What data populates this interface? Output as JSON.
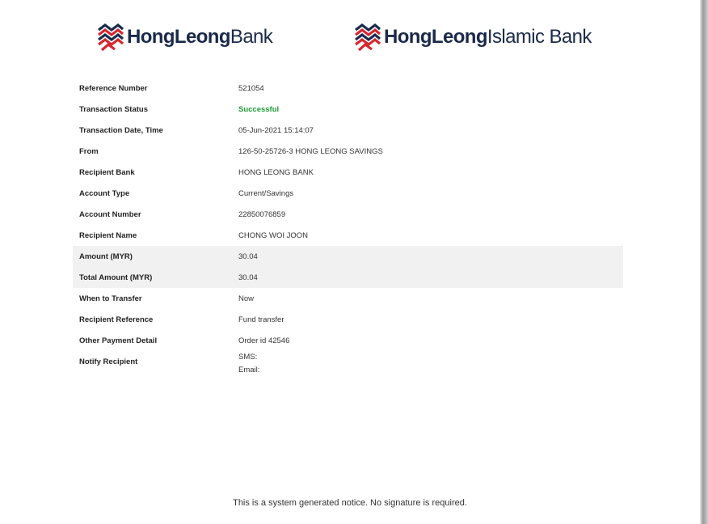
{
  "logos": {
    "hlb": {
      "bold": "HongLeong",
      "regular": "Bank"
    },
    "hlib": {
      "bold": "HongLeong",
      "regular": "Islamic Bank"
    }
  },
  "colors": {
    "brand_navy": "#1b2a4a",
    "brand_red": "#d7262f",
    "success_green": "#1f9d3a",
    "highlight_row": "#f1f1f1"
  },
  "details": [
    {
      "label": "Reference Number",
      "value": "521054"
    },
    {
      "label": "Transaction Status",
      "value": "Successful"
    },
    {
      "label": "Transaction Date, Time",
      "value": "05-Jun-2021 15:14:07"
    },
    {
      "label": "From",
      "value": "126-50-25726-3 HONG LEONG SAVINGS"
    },
    {
      "label": "Recipient Bank",
      "value": "HONG LEONG BANK"
    },
    {
      "label": "Account Type",
      "value": "Current/Savings"
    },
    {
      "label": "Account Number",
      "value": "22850076859"
    },
    {
      "label": "Recipient Name",
      "value": "CHONG WOI JOON"
    },
    {
      "label": "Amount (MYR)",
      "value": "30.04"
    },
    {
      "label": "Total Amount (MYR)",
      "value": "30.04"
    },
    {
      "label": "When to Transfer",
      "value": "Now"
    },
    {
      "label": "Recipient Reference",
      "value": "Fund transfer"
    },
    {
      "label": "Other Payment Detail",
      "value": "Order id 42546"
    }
  ],
  "notify": {
    "label": "Notify Recipient",
    "sms": "SMS:",
    "email": "Email:"
  },
  "footer": "This is a system generated notice. No signature is required."
}
